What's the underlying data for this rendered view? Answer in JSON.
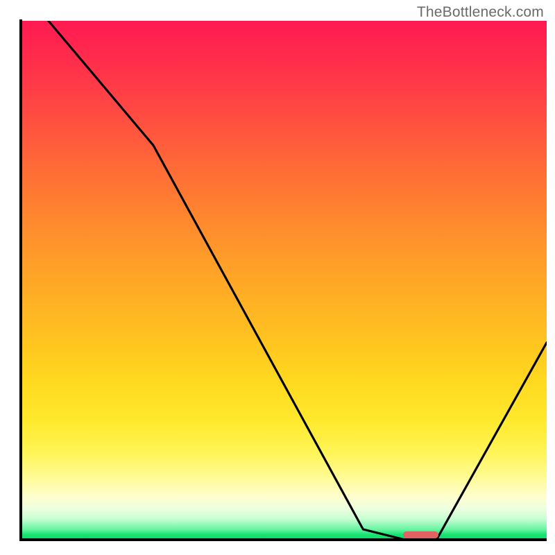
{
  "watermark": "TheBottleneck.com",
  "chart_data": {
    "type": "line",
    "title": "",
    "xlabel": "",
    "ylabel": "",
    "xlim": [
      0,
      100
    ],
    "ylim": [
      0,
      100
    ],
    "grid": false,
    "x": [
      0,
      5,
      25,
      65,
      73,
      79,
      100
    ],
    "values": [
      105,
      100,
      76,
      2,
      0,
      0,
      38
    ],
    "notes": "Black curve: high at left, slight bend near x≈25, descends to 0 around x≈73, flat near 0 until x≈79, then rises to ≈38 at right edge. Background is vertical spectral gradient red→green. Red pill marker sits on the flat minimum around x≈73–79.",
    "marker": {
      "x_start": 73,
      "x_end": 79,
      "y": 0,
      "color": "#e06262"
    }
  },
  "colors": {
    "axis": "#000000",
    "curve": "#000000",
    "marker": "#e06262",
    "watermark": "#6a6a6a"
  }
}
